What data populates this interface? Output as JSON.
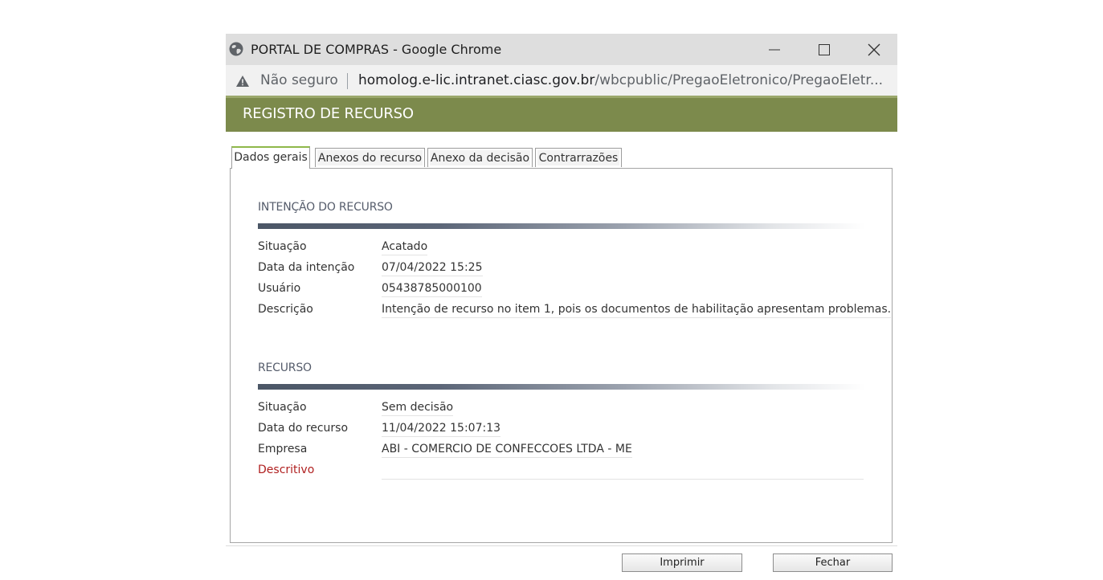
{
  "window": {
    "title": "PORTAL DE COMPRAS - Google Chrome",
    "icon": "globe-icon"
  },
  "address_bar": {
    "security_label": "Não seguro",
    "url_host": "homolog.e-lic.intranet.ciasc.gov.br",
    "url_path": "/wbcpublic/PregaoEletronico/PregaoEletr..."
  },
  "header": {
    "title": "REGISTRO DE RECURSO",
    "color": "#7c8a4c"
  },
  "tabs": [
    {
      "label": "Dados gerais",
      "active": true
    },
    {
      "label": "Anexos do recurso",
      "active": false
    },
    {
      "label": "Anexo da decisão",
      "active": false
    },
    {
      "label": "Contrarrazões",
      "active": false
    }
  ],
  "intencao": {
    "title": "INTENÇÃO DO RECURSO",
    "fields": [
      {
        "label": "Situação",
        "value": "Acatado"
      },
      {
        "label": "Data da intenção",
        "value": "07/04/2022 15:25"
      },
      {
        "label": "Usuário",
        "value": "05438785000100"
      },
      {
        "label": "Descrição",
        "value": "Intenção de recurso no item 1, pois os documentos de habilitação apresentam problemas."
      }
    ]
  },
  "recurso": {
    "title": "RECURSO",
    "fields": [
      {
        "label": "Situação",
        "value": "Sem decisão"
      },
      {
        "label": "Data do recurso",
        "value": "11/04/2022 15:07:13"
      },
      {
        "label": "Empresa",
        "value": "ABI - COMERCIO DE CONFECCOES LTDA - ME"
      },
      {
        "label": "Descritivo",
        "value": ""
      }
    ]
  },
  "footer": {
    "print_label": "Imprimir",
    "close_label": "Fechar"
  }
}
